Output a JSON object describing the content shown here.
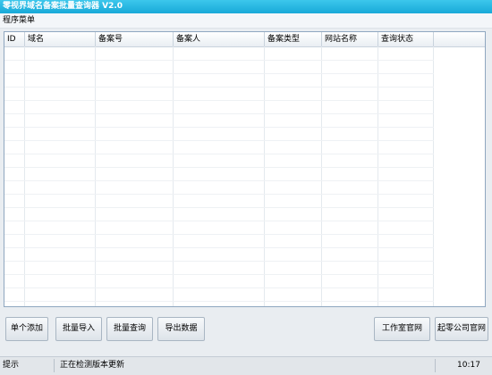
{
  "window": {
    "title": "零视界域名备案批量查询器 V2.0"
  },
  "menu": {
    "items": [
      "程序菜单"
    ]
  },
  "table": {
    "columns": [
      "ID",
      "域名",
      "备案号",
      "备案人",
      "备案类型",
      "网站名称",
      "查询状态"
    ],
    "rows": []
  },
  "buttons": {
    "single_add": "单个添加",
    "batch_import": "批量导入",
    "batch_query": "批量查询",
    "export_data": "导出数据",
    "studio_site": "工作室官网",
    "company_site": "起零公司官网"
  },
  "status": {
    "label": "提示",
    "message": "正在检测版本更新",
    "time": "10:17"
  }
}
